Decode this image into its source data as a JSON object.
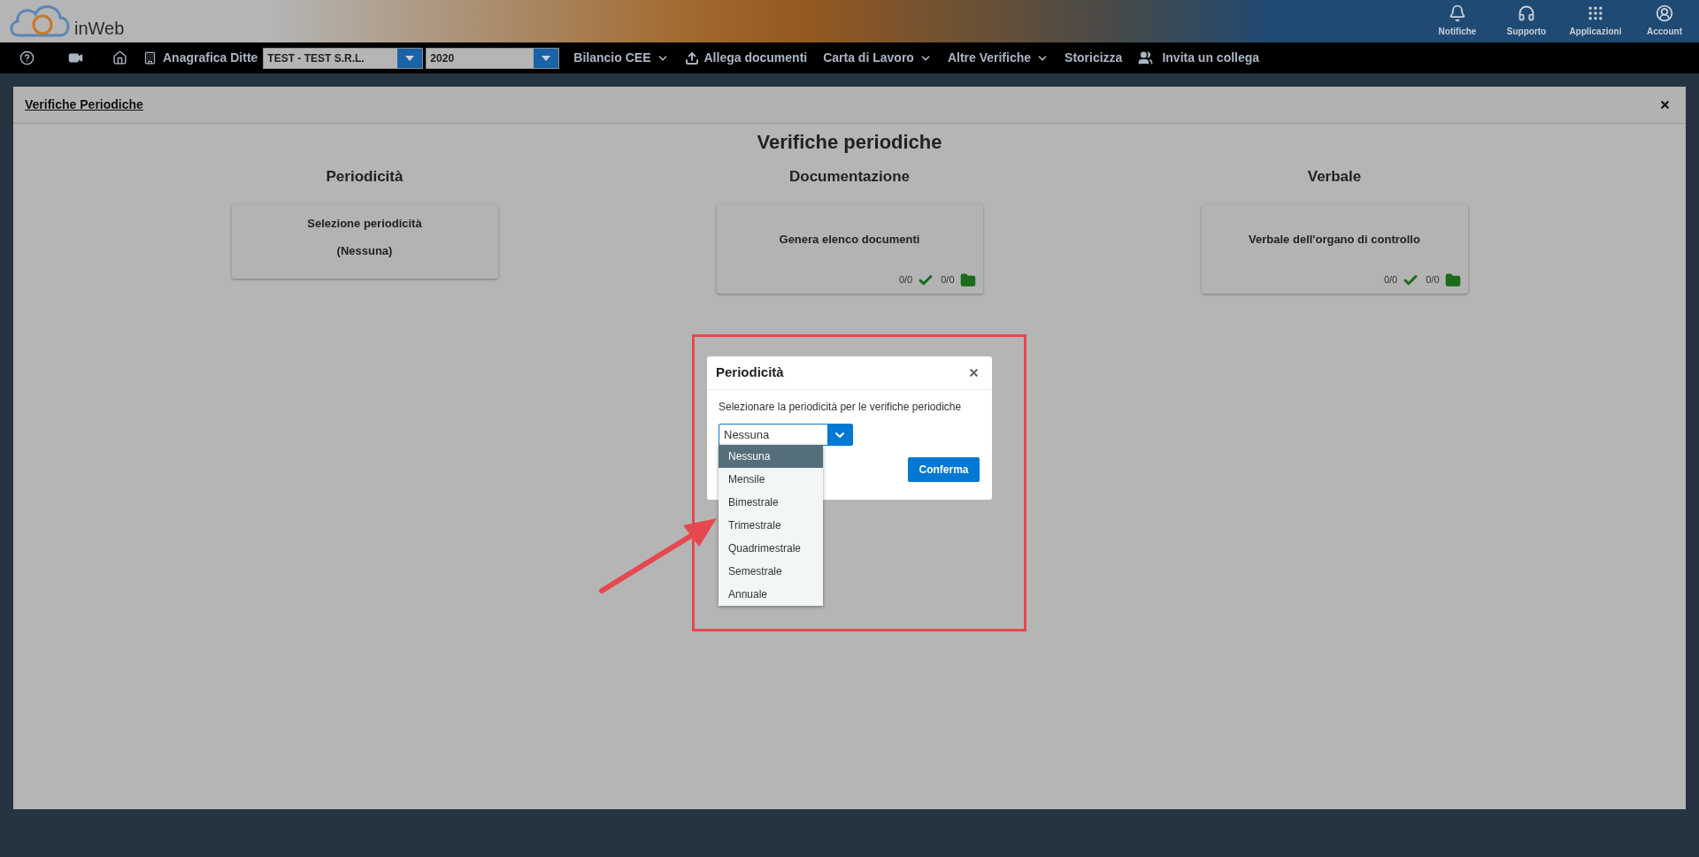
{
  "header": {
    "logo_text": "inWeb",
    "actions": [
      {
        "label": "Notifiche"
      },
      {
        "label": "Supporto"
      },
      {
        "label": "Applicazioni"
      },
      {
        "label": "Account"
      }
    ]
  },
  "navbar": {
    "company_label": "Anagrafica Ditte",
    "company_select": {
      "value": "TEST - TEST S.R.L."
    },
    "year_select": {
      "value": "2020"
    },
    "menus": [
      {
        "label": "Bilancio CEE",
        "dropdown": true,
        "kind": "menu"
      },
      {
        "label": "Allega documenti",
        "dropdown": false,
        "kind": "upload"
      },
      {
        "label": "Carta di Lavoro",
        "dropdown": true,
        "kind": "menu"
      },
      {
        "label": "Altre Verifiche",
        "dropdown": true,
        "kind": "menu"
      },
      {
        "label": "Storicizza",
        "dropdown": false,
        "kind": "menu"
      },
      {
        "label": "Invita un collega",
        "dropdown": false,
        "kind": "invite"
      }
    ]
  },
  "panel": {
    "title": "Verifiche Periodiche",
    "heading": "Verifiche periodiche",
    "columns": [
      {
        "heading": "Periodicità",
        "card": {
          "title": "Selezione periodicità",
          "subtitle": "(Nessuna)"
        }
      },
      {
        "heading": "Documentazione",
        "card": {
          "title": "Genera elenco documenti",
          "counters": [
            "0/0",
            "0/0"
          ]
        }
      },
      {
        "heading": "Verbale",
        "card": {
          "title": "Verbale dell'organo di controllo",
          "counters": [
            "0/0",
            "0/0"
          ]
        }
      }
    ]
  },
  "modal": {
    "title": "Periodicità",
    "message": "Selezionare la periodicità per le verifiche periodiche",
    "select": {
      "value": "Nessuna"
    },
    "options": [
      {
        "label": "Nessuna",
        "selected": true
      },
      {
        "label": "Mensile",
        "selected": false
      },
      {
        "label": "Bimestrale",
        "selected": false
      },
      {
        "label": "Trimestrale",
        "selected": false
      },
      {
        "label": "Quadrimestrale",
        "selected": false
      },
      {
        "label": "Semestrale",
        "selected": false
      },
      {
        "label": "Annuale",
        "selected": false
      }
    ],
    "confirm": "Conferma"
  }
}
